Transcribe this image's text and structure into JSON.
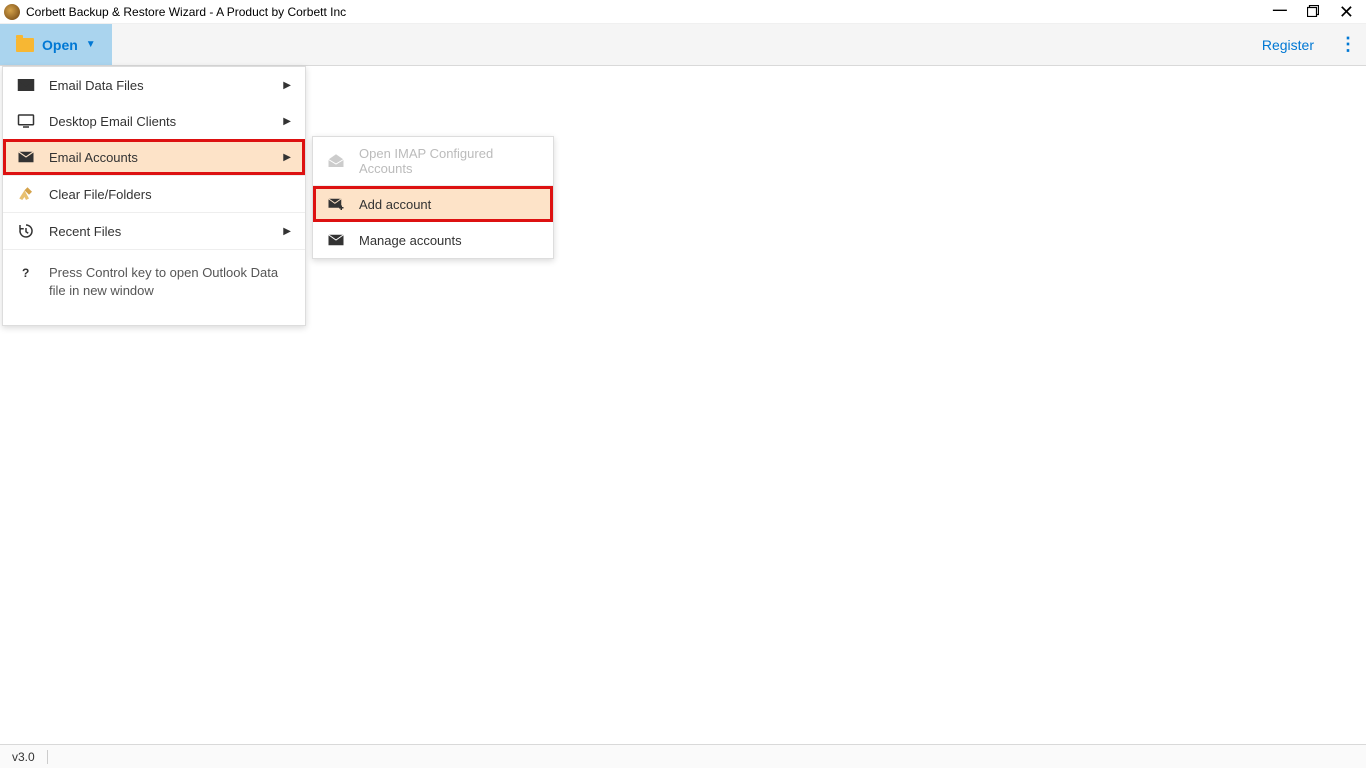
{
  "window": {
    "title": "Corbett Backup & Restore Wizard  - A Product by Corbett Inc"
  },
  "toolbar": {
    "open_label": "Open",
    "register_label": "Register"
  },
  "dropdown": {
    "email_data_files": "Email Data Files",
    "desktop_email_clients": "Desktop Email Clients",
    "email_accounts": "Email Accounts",
    "clear_file_folders": "Clear File/Folders",
    "recent_files": "Recent Files",
    "help_hint": "Press Control key to open Outlook Data file in new window"
  },
  "submenu": {
    "open_imap": "Open IMAP Configured Accounts",
    "add_account": "Add account",
    "manage_accounts": "Manage accounts"
  },
  "status": {
    "version": "v3.0"
  }
}
